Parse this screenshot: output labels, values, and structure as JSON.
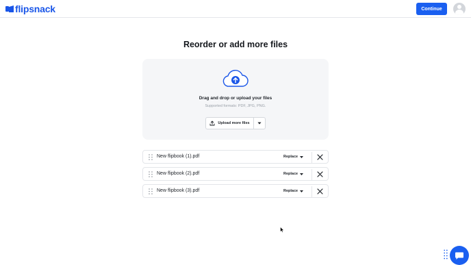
{
  "header": {
    "brand": "flipsnack",
    "continue_label": "Continue",
    "avatar_icon": "user-avatar-icon"
  },
  "main": {
    "title": "Reorder or add more files",
    "dropzone": {
      "icon": "cloud-upload-icon",
      "title": "Drag and drop or upload your files",
      "subtitle": "Supported formats: PDF, JPG, PNG.",
      "upload_label": "Upload more files"
    },
    "files": [
      {
        "name": "New flipbook (1).pdf",
        "action": "Replace"
      },
      {
        "name": "New flipbook (2).pdf",
        "action": "Replace"
      },
      {
        "name": "New flipbook (3).pdf",
        "action": "Replace"
      }
    ]
  },
  "colors": {
    "accent": "#1a5ff0",
    "brand": "#1a56e8",
    "dropzone_bg": "#f5f6f8"
  },
  "widgets": {
    "chat_icon": "chat-bubble-icon"
  }
}
